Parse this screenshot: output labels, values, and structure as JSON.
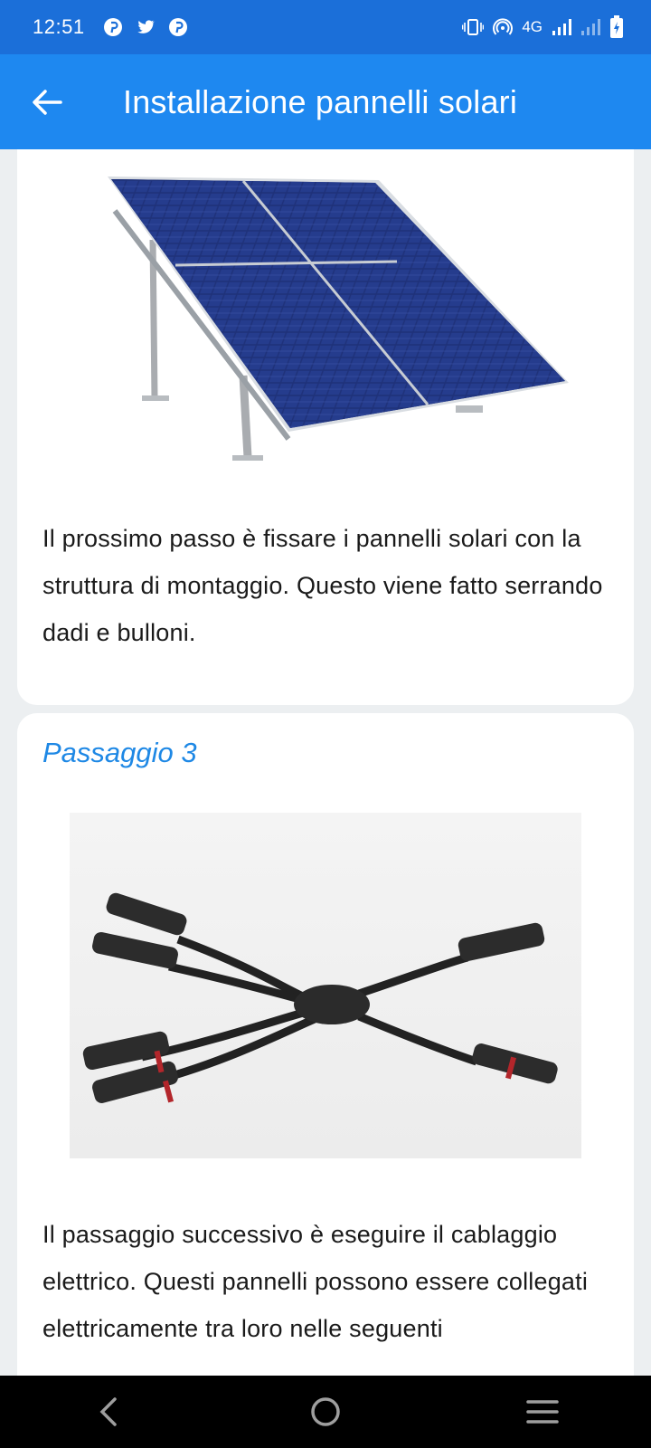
{
  "status_bar": {
    "time": "12:51",
    "network": "4G",
    "icons": [
      "pinterest-icon",
      "twitter-icon",
      "pinterest-icon",
      "vibrate-icon",
      "hotspot-icon",
      "signal-icon",
      "signal-icon",
      "battery-charging-icon"
    ]
  },
  "app_bar": {
    "title": "Installazione pannelli solari",
    "back_icon": "arrow-left-icon"
  },
  "cards": [
    {
      "image": "solar-panel-mount-image",
      "text": "Il prossimo passo è fissare i pannelli solari con la struttura di montaggio. Questo viene fatto serrando dadi e bulloni."
    },
    {
      "title": "Passaggio 3",
      "image": "mc4-branch-connector-image",
      "text": "Il passaggio successivo è eseguire il cablaggio elettrico. Questi pannelli possono essere collegati elettricamente tra loro nelle seguenti"
    }
  ],
  "nav_bar": {
    "icons": [
      "back-icon",
      "home-icon",
      "menu-icon"
    ]
  },
  "colors": {
    "status_bar": "#1b6fd9",
    "app_bar": "#1e88f0",
    "accent": "#1e88e5",
    "background": "#eceff1"
  }
}
